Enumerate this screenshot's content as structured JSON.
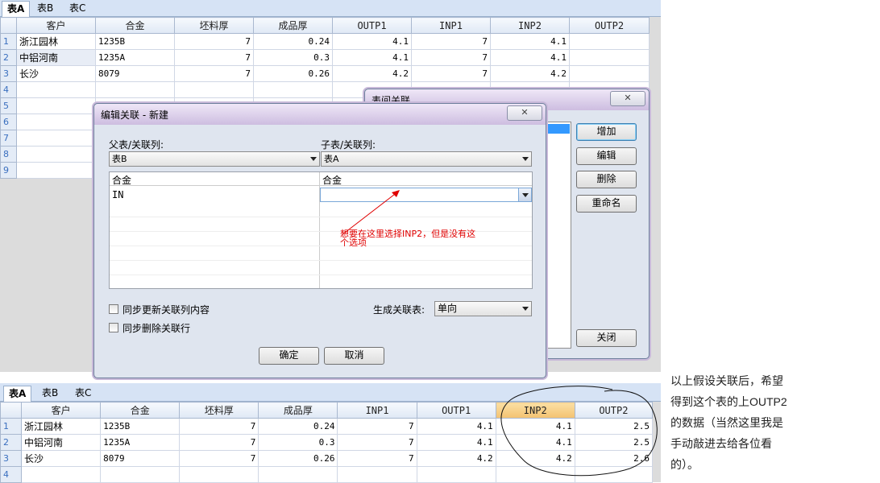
{
  "top_sheet": {
    "tabs": [
      "表A",
      "表B",
      "表C"
    ],
    "columns": [
      "客户",
      "合金",
      "坯料厚",
      "成品厚",
      "OUTP1",
      "INP1",
      "INP2",
      "OUTP2"
    ],
    "rows": [
      {
        "n": "1",
        "c": [
          "浙江园林",
          "1235B",
          "7",
          "0.24",
          "4.1",
          "7",
          "4.1",
          ""
        ]
      },
      {
        "n": "2",
        "c": [
          "中铝河南",
          "1235A",
          "7",
          "0.3",
          "4.1",
          "7",
          "4.1",
          ""
        ]
      },
      {
        "n": "3",
        "c": [
          "长沙",
          "8079",
          "7",
          "0.26",
          "4.2",
          "7",
          "4.2",
          ""
        ]
      },
      {
        "n": "4",
        "c": [
          "",
          "",
          "",
          "",
          "",
          "",
          "",
          ""
        ]
      },
      {
        "n": "5",
        "c": [
          "",
          "",
          "",
          "",
          "",
          "",
          "",
          ""
        ]
      },
      {
        "n": "6",
        "c": [
          "",
          "",
          "",
          "",
          "",
          "",
          "",
          ""
        ]
      },
      {
        "n": "7",
        "c": [
          "",
          "",
          "",
          "",
          "",
          "",
          "",
          ""
        ]
      },
      {
        "n": "8",
        "c": [
          "",
          "",
          "",
          "",
          "",
          "",
          "",
          ""
        ]
      },
      {
        "n": "9",
        "c": [
          "",
          "",
          "",
          "",
          "",
          "",
          "",
          ""
        ]
      }
    ]
  },
  "relations_dialog": {
    "title": "表间关联",
    "close": "✕",
    "buttons": {
      "add": "增加",
      "edit": "编辑",
      "delete": "删除",
      "rename": "重命名",
      "close": "关闭"
    }
  },
  "edit_dialog": {
    "title": "编辑关联 - 新建",
    "close": "✕",
    "parent_label": "父表/关联列:",
    "parent_value": "表B",
    "child_label": "子表/关联列:",
    "child_value": "表A",
    "grid_headers": [
      "合金",
      "合金"
    ],
    "grid_row": [
      "IN",
      ""
    ],
    "annotation": "想要在这里选择INP2，但是没有这个选项",
    "sync_update": "同步更新关联列内容",
    "sync_delete": "同步删除关联行",
    "gen_label": "生成关联表:",
    "gen_value": "单向",
    "ok": "确定",
    "cancel": "取消"
  },
  "bottom_sheet": {
    "tabs": [
      "表A",
      "表B",
      "表C"
    ],
    "columns": [
      "客户",
      "合金",
      "坯料厚",
      "成品厚",
      "INP1",
      "OUTP1",
      "INP2",
      "OUTP2"
    ],
    "rows": [
      {
        "n": "1",
        "c": [
          "浙江园林",
          "1235B",
          "7",
          "0.24",
          "7",
          "4.1",
          "4.1",
          "2.5"
        ]
      },
      {
        "n": "2",
        "c": [
          "中铝河南",
          "1235A",
          "7",
          "0.3",
          "7",
          "4.1",
          "4.1",
          "2.5"
        ]
      },
      {
        "n": "3",
        "c": [
          "长沙",
          "8079",
          "7",
          "0.26",
          "7",
          "4.2",
          "4.2",
          "2.6"
        ]
      },
      {
        "n": "4",
        "c": [
          "",
          "",
          "",
          "",
          "",
          "",
          "",
          ""
        ]
      }
    ]
  },
  "side_note": "以上假设关联后，希望得到这个表的上OUTP2的数据（当然这里我是手动敲进去给各位看的）。"
}
